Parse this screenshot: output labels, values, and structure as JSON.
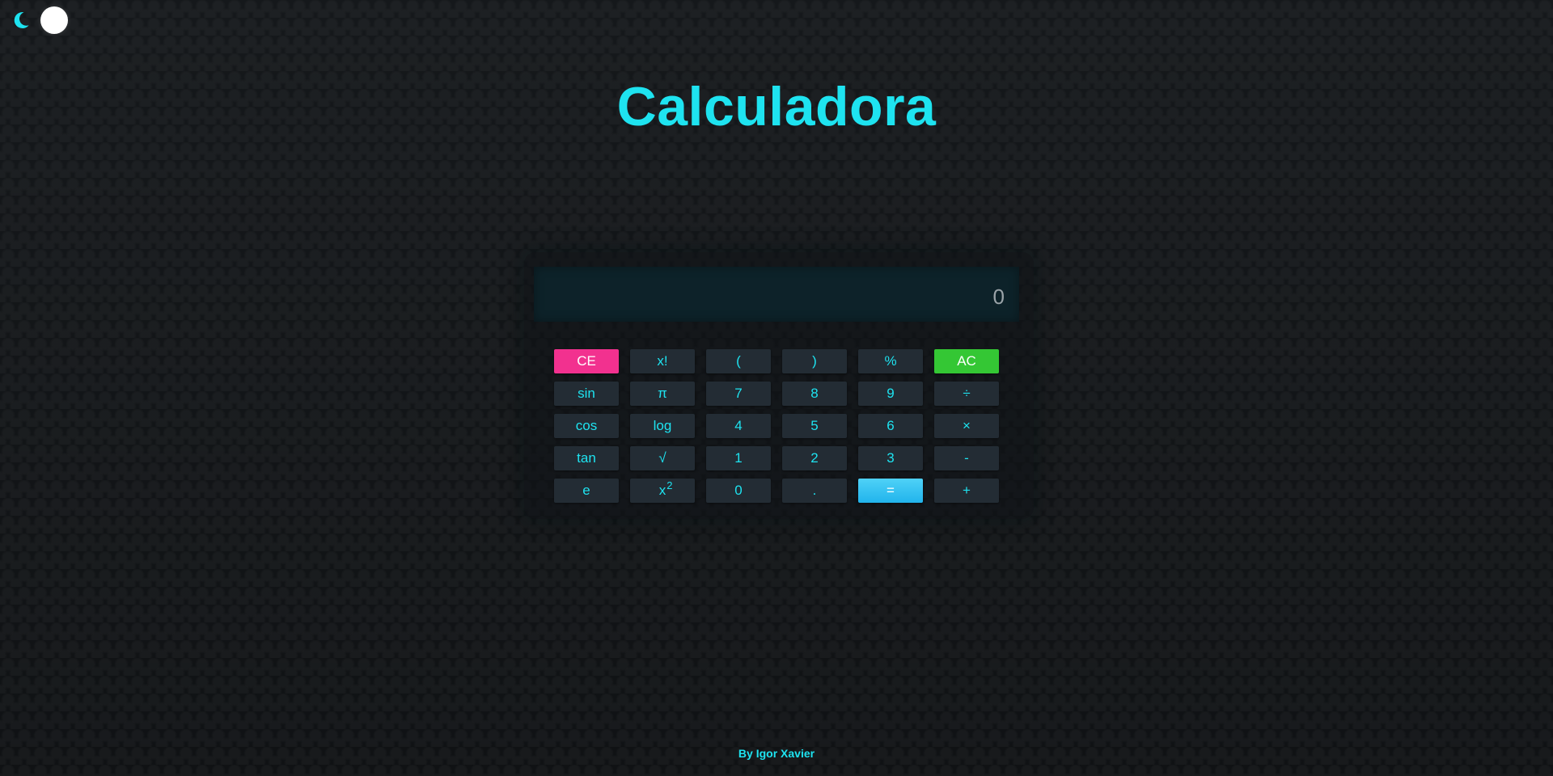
{
  "header": {
    "theme_toggle": {
      "icon": "moon-icon",
      "knob": "toggle-knob",
      "accent_color": "#1ee3f0"
    }
  },
  "page": {
    "title": "Calculadora"
  },
  "calculator": {
    "display": {
      "value": "0"
    },
    "keys": [
      [
        {
          "label": "CE",
          "name": "clear-entry-button",
          "style": "ce"
        },
        {
          "label": "x!",
          "name": "factorial-button"
        },
        {
          "label": "(",
          "name": "open-paren-button"
        },
        {
          "label": ")",
          "name": "close-paren-button"
        },
        {
          "label": "%",
          "name": "percent-button"
        },
        {
          "label": "AC",
          "name": "all-clear-button",
          "style": "ac"
        }
      ],
      [
        {
          "label": "sin",
          "name": "sin-button"
        },
        {
          "label": "π",
          "name": "pi-button"
        },
        {
          "label": "7",
          "name": "digit-7-button"
        },
        {
          "label": "8",
          "name": "digit-8-button"
        },
        {
          "label": "9",
          "name": "digit-9-button"
        },
        {
          "label": "÷",
          "name": "divide-button"
        }
      ],
      [
        {
          "label": "cos",
          "name": "cos-button"
        },
        {
          "label": "log",
          "name": "log-button"
        },
        {
          "label": "4",
          "name": "digit-4-button"
        },
        {
          "label": "5",
          "name": "digit-5-button"
        },
        {
          "label": "6",
          "name": "digit-6-button"
        },
        {
          "label": "×",
          "name": "multiply-button"
        }
      ],
      [
        {
          "label": "tan",
          "name": "tan-button"
        },
        {
          "label": "√",
          "name": "sqrt-button"
        },
        {
          "label": "1",
          "name": "digit-1-button"
        },
        {
          "label": "2",
          "name": "digit-2-button"
        },
        {
          "label": "3",
          "name": "digit-3-button"
        },
        {
          "label": "-",
          "name": "subtract-button"
        }
      ],
      [
        {
          "label": "e",
          "name": "euler-button"
        },
        {
          "label": "x",
          "sup": "2",
          "name": "square-button"
        },
        {
          "label": "0",
          "name": "digit-0-button"
        },
        {
          "label": ".",
          "name": "decimal-button"
        },
        {
          "label": "=",
          "name": "equals-button",
          "style": "eq"
        },
        {
          "label": "+",
          "name": "add-button"
        }
      ]
    ],
    "colors": {
      "clear_entry": "#f2318f",
      "all_clear": "#34c734",
      "equals": "#21b4ec",
      "key_text": "#1ee3f0",
      "key_bg": "#232c34"
    }
  },
  "footer": {
    "credit": "By Igor Xavier"
  }
}
